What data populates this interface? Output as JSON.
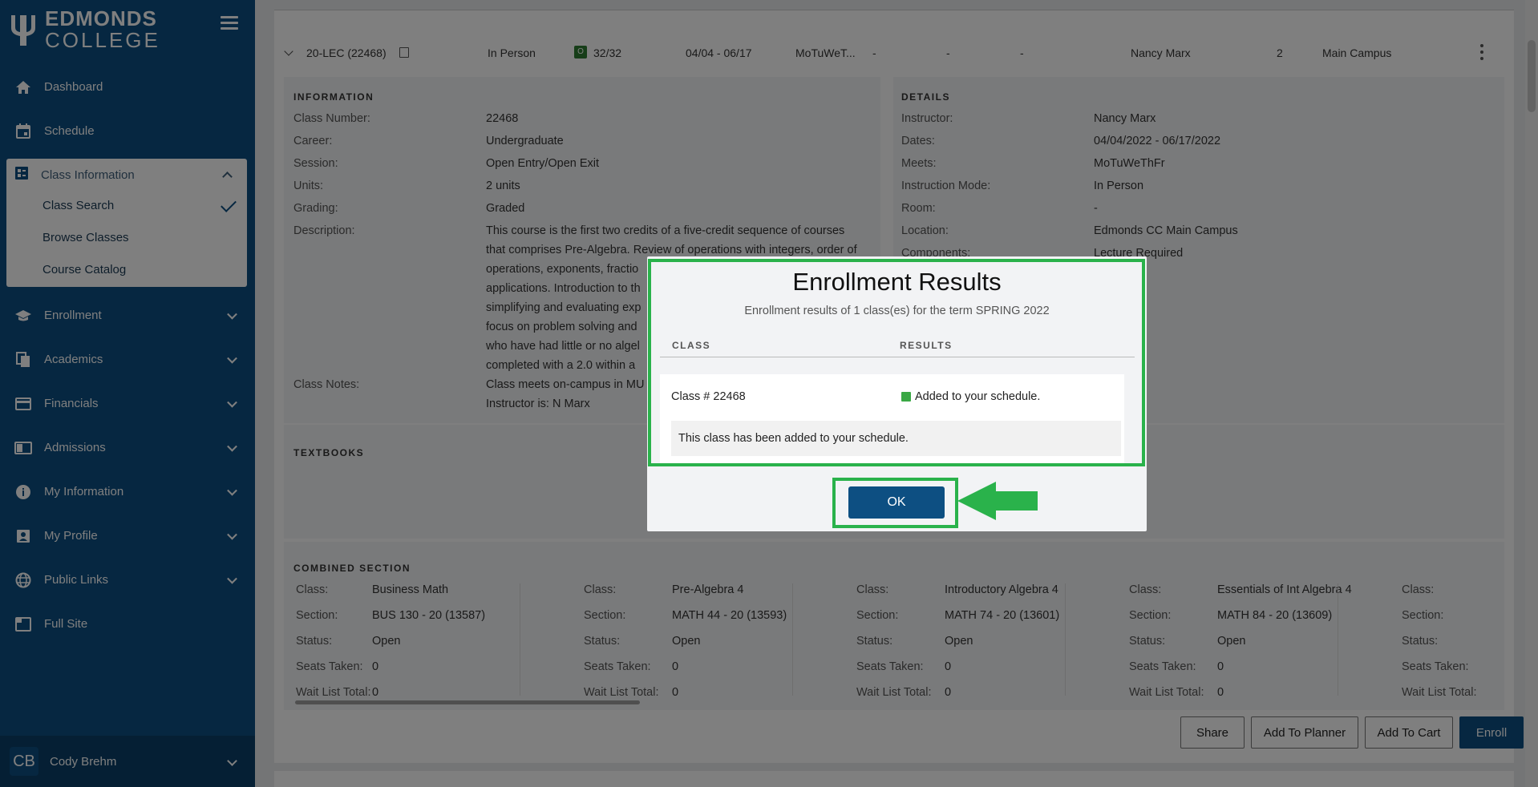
{
  "sidebar": {
    "logo": {
      "line1": "EDMONDS",
      "line2": "COLLEGE"
    },
    "nav": [
      {
        "label": "Dashboard",
        "icon": "home-icon"
      },
      {
        "label": "Schedule",
        "icon": "calendar-icon"
      },
      {
        "label": "Enrollment",
        "icon": "graduation-cap-icon"
      },
      {
        "label": "Academics",
        "icon": "documents-icon"
      },
      {
        "label": "Financials",
        "icon": "credit-card-icon"
      },
      {
        "label": "Admissions",
        "icon": "id-card-icon"
      },
      {
        "label": "My Information",
        "icon": "info-icon"
      },
      {
        "label": "My Profile",
        "icon": "profile-icon"
      },
      {
        "label": "Public Links",
        "icon": "globe-icon"
      },
      {
        "label": "Full Site",
        "icon": "open-window-icon"
      }
    ],
    "class_information": {
      "label": "Class Information",
      "items": [
        "Class Search",
        "Browse Classes",
        "Course Catalog"
      ],
      "selected": "Class Search"
    },
    "user": {
      "initials": "CB",
      "name": "Cody Brehm"
    }
  },
  "section": {
    "title": "20-LEC (22468)",
    "mode": "In Person",
    "status_badge": "O",
    "seats": "32/32",
    "dates": "04/04 - 06/17",
    "meets": "MoTuWeT...",
    "dash1": "-",
    "dash2": "-",
    "dash3": "-",
    "instructor": "Nancy Marx",
    "units": "2",
    "campus": "Main Campus"
  },
  "information": {
    "heading": "INFORMATION",
    "class_number_label": "Class Number:",
    "class_number": "22468",
    "career_label": "Career:",
    "career": "Undergraduate",
    "session_label": "Session:",
    "session": "Open Entry/Open Exit",
    "units_label": "Units:",
    "units": "2 units",
    "grading_label": "Grading:",
    "grading": "Graded",
    "description_label": "Description:",
    "description_lines": [
      "This course is the first two credits of a five-credit sequence of courses",
      "that comprises Pre-Algebra. Review of operations with integers, order of",
      "operations, exponents, fractio",
      "applications. Introduction to th",
      "simplifying and evaluating exp",
      "focus on problem solving and",
      "who have had little or no algel",
      "completed with a 2.0 within a"
    ],
    "notes_label": "Class Notes:",
    "notes_lines": [
      "Class meets on-campus in MU",
      "Instructor is: N Marx"
    ]
  },
  "details": {
    "heading": "DETAILS",
    "instructor_label": "Instructor:",
    "instructor": "Nancy Marx",
    "dates_label": "Dates:",
    "dates": "04/04/2022 - 06/17/2022",
    "meets_label": "Meets:",
    "meets": "MoTuWeThFr",
    "mode_label": "Instruction Mode:",
    "mode": "In Person",
    "room_label": "Room:",
    "room": "-",
    "location_label": "Location:",
    "location": "Edmonds CC Main Campus",
    "components_label": "Components:",
    "components": "Lecture Required"
  },
  "textbooks": {
    "heading": "TEXTBOOKS"
  },
  "combined": {
    "heading": "COMBINED SECTION",
    "labels": [
      "Class:",
      "Section:",
      "Status:",
      "Seats Taken:",
      "Wait List Total:"
    ],
    "columns": [
      {
        "class": "Business Math",
        "section": "BUS 130 - 20 (13587)",
        "status": "Open",
        "seats": "0",
        "waitlist": "0"
      },
      {
        "class": "Pre-Algebra 4",
        "section": "MATH 44 - 20 (13593)",
        "status": "Open",
        "seats": "0",
        "waitlist": "0"
      },
      {
        "class": "Introductory Algebra 4",
        "section": "MATH 74 - 20 (13601)",
        "status": "Open",
        "seats": "0",
        "waitlist": "0"
      },
      {
        "class": "Essentials of Int Algebra 4",
        "section": "MATH 84 - 20 (13609)",
        "status": "Open",
        "seats": "0",
        "waitlist": "0"
      }
    ]
  },
  "actions": {
    "share": "Share",
    "planner": "Add To Planner",
    "cart": "Add To Cart",
    "enroll": "Enroll"
  },
  "modal": {
    "title": "Enrollment Results",
    "subtitle": "Enrollment results of 1 class(es) for the term SPRING 2022",
    "col_class": "CLASS",
    "col_results": "RESULTS",
    "class_text": "Class # 22468",
    "result_text": "Added to your schedule.",
    "message": "This class has been added to your schedule.",
    "ok": "OK",
    "result_color": "#3aa845"
  },
  "colors": {
    "brand": "#0d4f82",
    "highlight": "#2ab24b"
  }
}
